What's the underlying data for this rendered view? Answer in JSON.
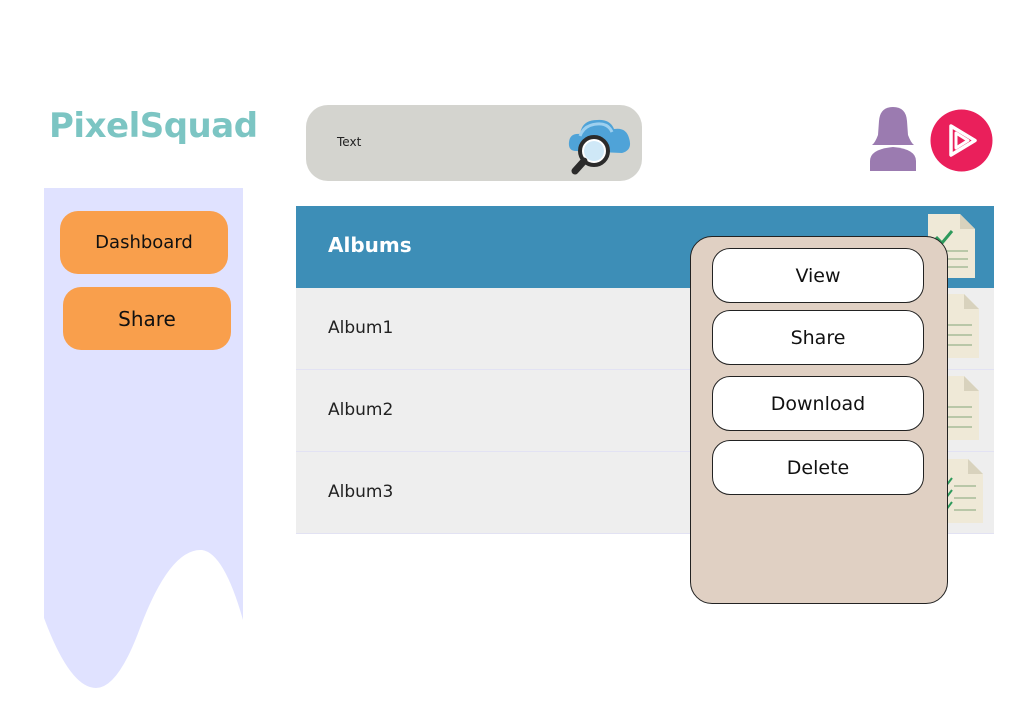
{
  "app": {
    "title": "PixelSquad"
  },
  "search": {
    "text": "Text"
  },
  "sidebar": {
    "items": [
      {
        "label": "Dashboard"
      },
      {
        "label": "Share"
      }
    ]
  },
  "table": {
    "header": "Albums",
    "rows": [
      {
        "label": "Album1"
      },
      {
        "label": "Album2"
      },
      {
        "label": "Album3"
      }
    ]
  },
  "context_menu": {
    "items": [
      {
        "label": "View"
      },
      {
        "label": "Share"
      },
      {
        "label": "Download"
      },
      {
        "label": "Delete"
      }
    ]
  },
  "colors": {
    "brand": "#7cc5c3",
    "accent_orange": "#f99f4c",
    "header_blue": "#3d8eb7",
    "sidebar_bg": "#e0e2ff",
    "menu_bg": "#e0d0c3",
    "play_red": "#ea1f5b",
    "user_purple": "#9b7bb0"
  },
  "icons": {
    "search": "cloud-search-icon",
    "user": "user-icon",
    "play": "play-icon",
    "document": "document-icon"
  }
}
